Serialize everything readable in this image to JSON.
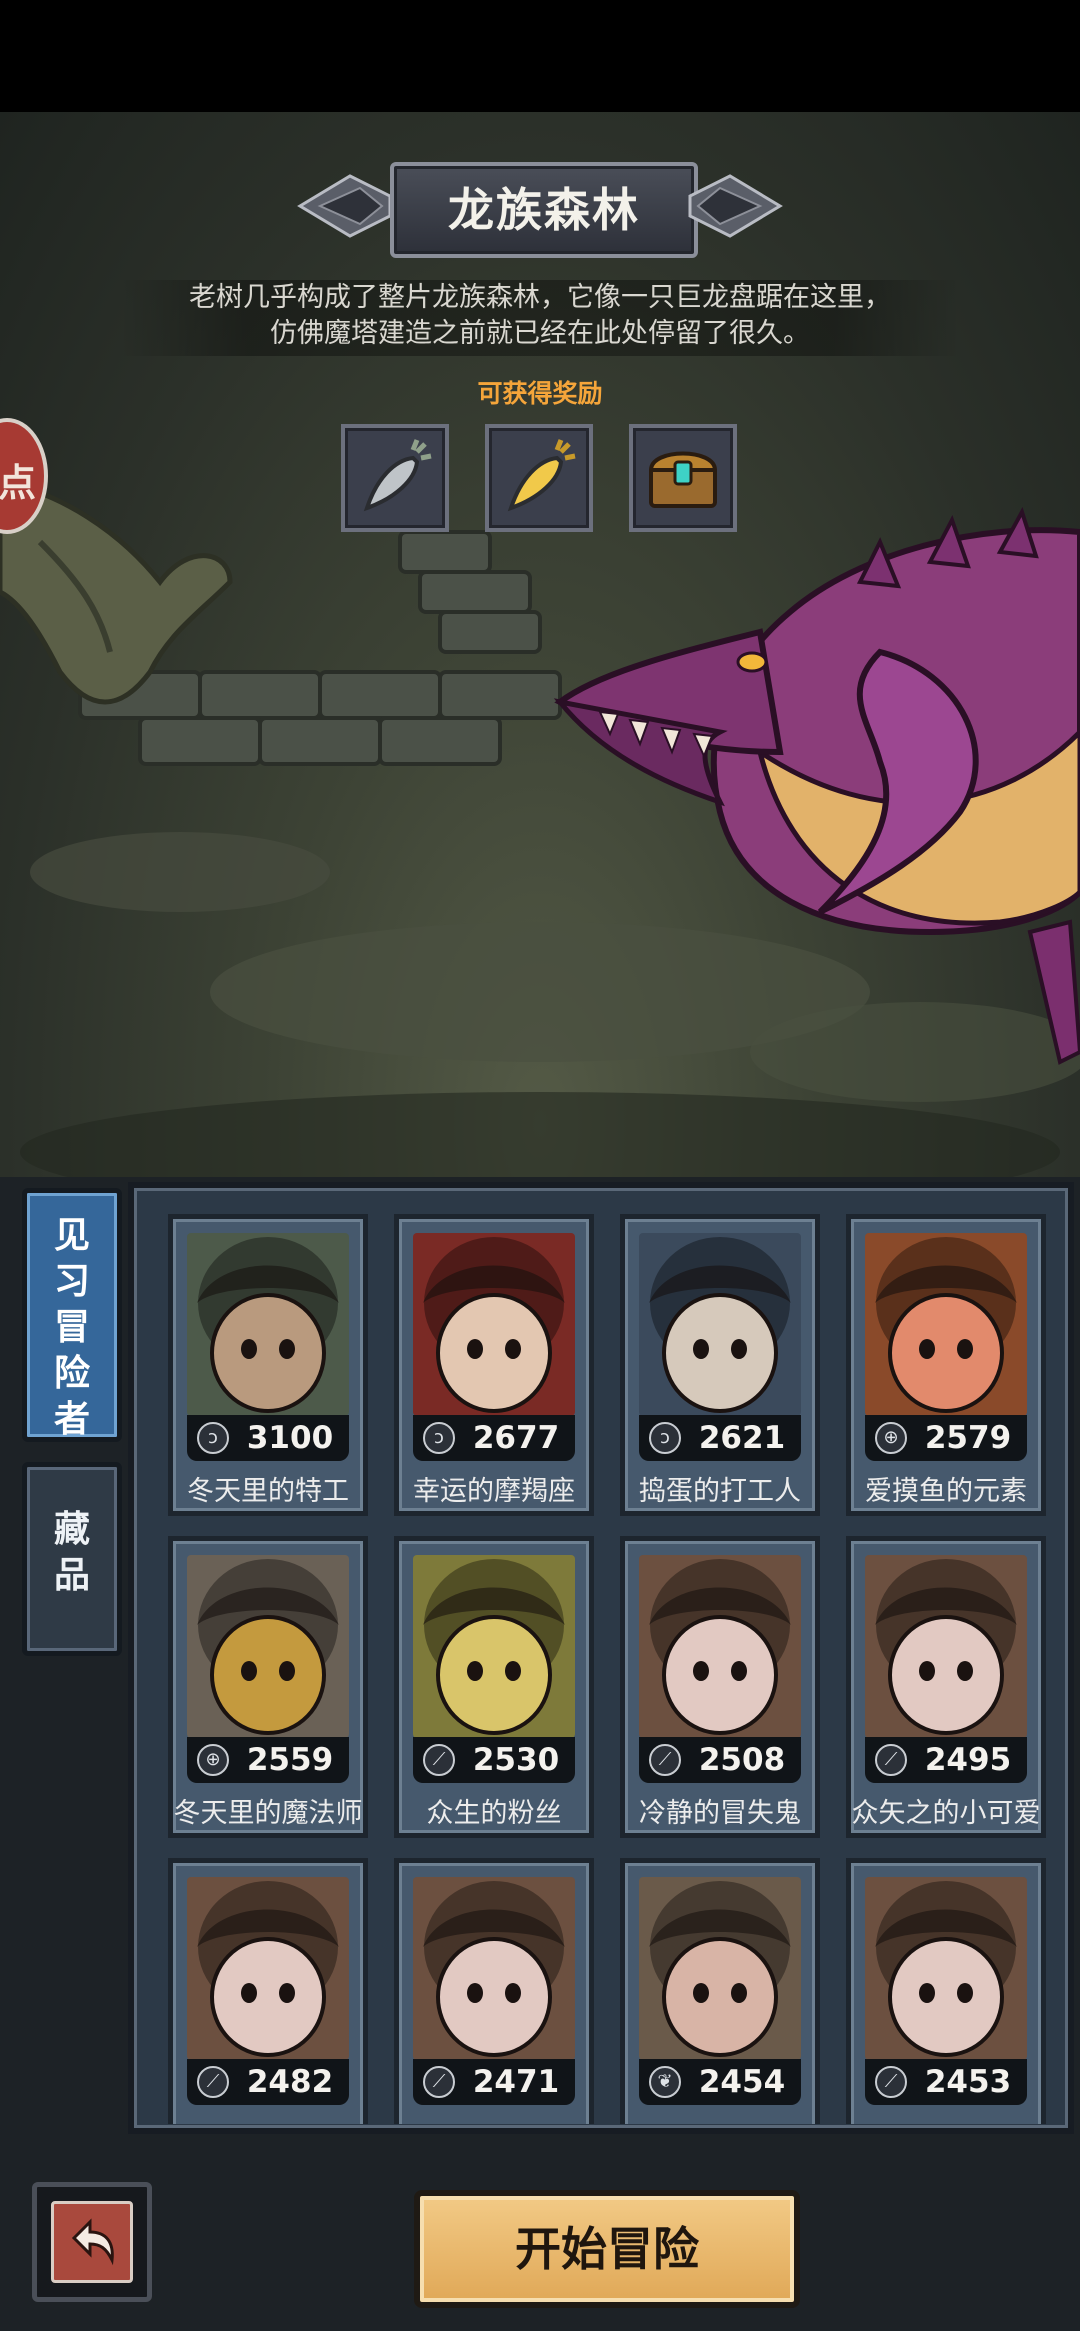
{
  "stage": {
    "title": "龙族森林",
    "description_lines": [
      "老树几乎构成了整片龙族森林，它像一只巨龙盘踞在这里，",
      "仿佛魔塔建造之前就已经在此处停留了很久。"
    ],
    "reward_label": "可获得奖励",
    "rewards": [
      {
        "icon": "silver-carrot-icon"
      },
      {
        "icon": "gold-carrot-icon"
      },
      {
        "icon": "treasure-chest-icon"
      }
    ],
    "side_badge": "点"
  },
  "tabs": [
    {
      "label": "见习冒险者",
      "active": true
    },
    {
      "label": "藏品",
      "active": false
    }
  ],
  "heroes": [
    {
      "power": "3100",
      "name": "冬天里的特工",
      "class_icon": "claw-icon",
      "palette": [
        "#4d5a4a",
        "#b99a7e"
      ]
    },
    {
      "power": "2677",
      "name": "幸运的摩羯座",
      "class_icon": "claw-icon",
      "palette": [
        "#7a2a25",
        "#e3c7b1"
      ]
    },
    {
      "power": "2621",
      "name": "捣蛋的打工人",
      "class_icon": "claw-icon",
      "palette": [
        "#3b4a5c",
        "#d6c9bb"
      ]
    },
    {
      "power": "2579",
      "name": "爱摸鱼的元素",
      "class_icon": "target-icon",
      "palette": [
        "#8a4a2a",
        "#e28a6c"
      ]
    },
    {
      "power": "2559",
      "name": "冬天里的魔法师",
      "class_icon": "target-icon",
      "palette": [
        "#6a6156",
        "#c49a3e"
      ]
    },
    {
      "power": "2530",
      "name": "众生的粉丝",
      "class_icon": "sword-icon",
      "palette": [
        "#7e7a3a",
        "#d9c56a"
      ]
    },
    {
      "power": "2508",
      "name": "冷静的冒失鬼",
      "class_icon": "sword-icon",
      "palette": [
        "#6c5040",
        "#e2c9c2"
      ]
    },
    {
      "power": "2495",
      "name": "众矢之的小可爱",
      "class_icon": "sword-icon",
      "palette": [
        "#6c5040",
        "#e2c9c2"
      ]
    },
    {
      "power": "2482",
      "name": "",
      "class_icon": "sword-icon",
      "palette": [
        "#6c5040",
        "#e2c9c2"
      ]
    },
    {
      "power": "2471",
      "name": "",
      "class_icon": "sword-icon",
      "palette": [
        "#6c5040",
        "#e2c9c2"
      ]
    },
    {
      "power": "2454",
      "name": "",
      "class_icon": "leaf-icon",
      "palette": [
        "#6a5a4a",
        "#d8b4a6"
      ]
    },
    {
      "power": "2453",
      "name": "",
      "class_icon": "sword-icon",
      "palette": [
        "#6c5040",
        "#e2c9c2"
      ]
    }
  ],
  "controls": {
    "start_label": "开始冒险",
    "back_icon": "return-arrow-icon"
  },
  "colors": {
    "accent_orange": "#f5a53a",
    "start_button": "#e8b865",
    "active_tab": "#35679a",
    "panel": "#2c3947"
  }
}
